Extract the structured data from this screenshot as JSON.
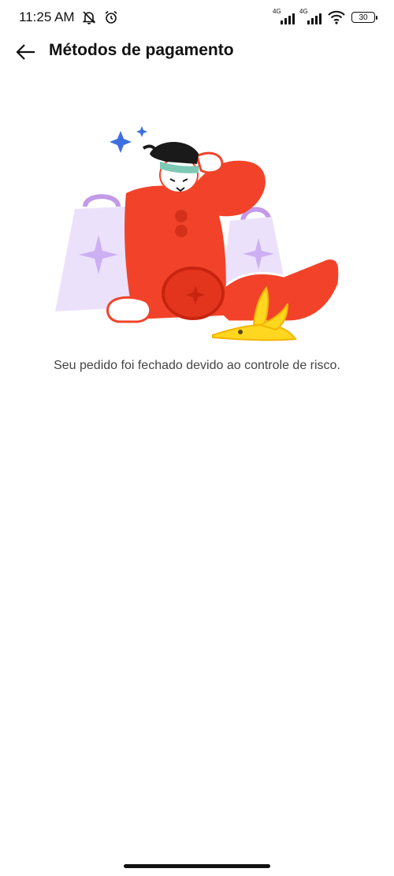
{
  "status_bar": {
    "time": "11:25 AM",
    "network_1": "4G",
    "network_2": "4G",
    "battery": "30"
  },
  "header": {
    "title": "Métodos de pagamento"
  },
  "main": {
    "message": "Seu pedido foi fechado devido ao controle de risco.",
    "illustration": "person-slipped-on-banana-illustration"
  },
  "colors": {
    "person": "#f2432a",
    "bag": "#e9dcfb",
    "banana": "#ffd620",
    "sparkle": "#3d6fe0",
    "text": "#444444"
  }
}
